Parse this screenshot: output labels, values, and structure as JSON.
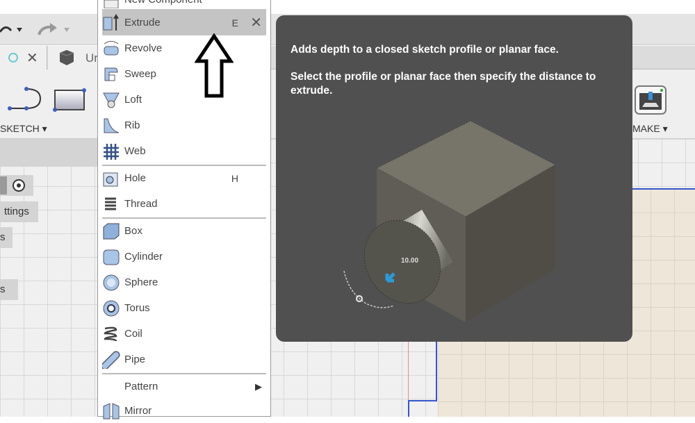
{
  "toolbar": {
    "sketch_label": "SKETCH ▾",
    "make_label": "MAKE ▾",
    "tab_label": "Ur",
    "undo_icon": "undo-icon",
    "redo_icon": "redo-icon"
  },
  "left_panel": {
    "settings_label": "ttings",
    "item_s1": "s",
    "item_s2": "s"
  },
  "menu": {
    "items": [
      {
        "label": "New Component",
        "icon": "new-component-icon"
      },
      {
        "label": "Extrude",
        "shortcut": "E",
        "icon": "extrude-icon"
      },
      {
        "label": "Revolve",
        "icon": "revolve-icon"
      },
      {
        "label": "Sweep",
        "icon": "sweep-icon"
      },
      {
        "label": "Loft",
        "icon": "loft-icon"
      },
      {
        "label": "Rib",
        "icon": "rib-icon"
      },
      {
        "label": "Web",
        "icon": "web-icon"
      },
      {
        "label": "Hole",
        "shortcut": "H",
        "icon": "hole-icon"
      },
      {
        "label": "Thread",
        "icon": "thread-icon"
      },
      {
        "label": "Box",
        "icon": "box-icon"
      },
      {
        "label": "Cylinder",
        "icon": "cylinder-icon"
      },
      {
        "label": "Sphere",
        "icon": "sphere-icon"
      },
      {
        "label": "Torus",
        "icon": "torus-icon"
      },
      {
        "label": "Coil",
        "icon": "coil-icon"
      },
      {
        "label": "Pipe",
        "icon": "pipe-icon"
      },
      {
        "label": "Pattern",
        "icon": "submenu-arrow-icon"
      },
      {
        "label": "Mirror",
        "icon": "mirror-icon"
      }
    ]
  },
  "tooltip": {
    "line1": "Adds depth to a closed sketch profile or planar face.",
    "line2": "Select the profile or planar face then specify the distance to extrude.",
    "dimension": "10.00"
  },
  "colors": {
    "highlight": "#c4c4c4",
    "tooltip_bg": "#505050",
    "sketch_line": "#3355cc",
    "accent_blue": "#2a9ad8"
  }
}
